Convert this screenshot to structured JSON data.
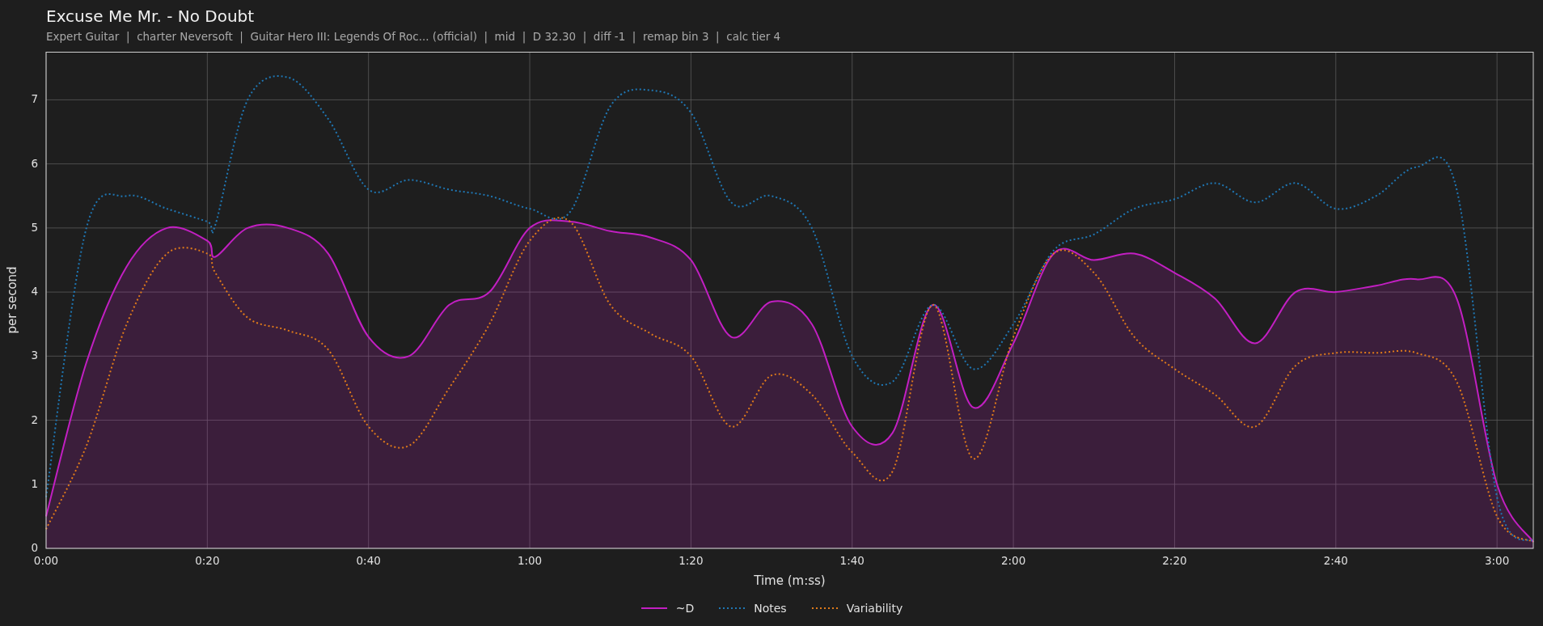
{
  "title": "Excuse Me Mr. - No Doubt",
  "subtitle": "Expert Guitar  |  charter Neversoft  |  Guitar Hero III: Legends Of Roc... (official)  |  mid  |  D 32.30  |  diff -1  |  remap bin 3  |  calc tier 4",
  "chart": {
    "chart_data": {
      "type": "line",
      "xlabel": "Time (m:ss)",
      "ylabel": "per second",
      "x": [
        0,
        5,
        10,
        15,
        20,
        21,
        25,
        30,
        35,
        40,
        45,
        50,
        55,
        60,
        65,
        70,
        75,
        80,
        85,
        90,
        95,
        100,
        105,
        110,
        115,
        120,
        125,
        130,
        135,
        140,
        145,
        150,
        155,
        160,
        165,
        170,
        175,
        180,
        184.5
      ],
      "series": [
        {
          "name": "~D",
          "color": "#c21fc2",
          "type": "area",
          "line_style": "solid",
          "values": [
            0.5,
            2.9,
            4.4,
            5.0,
            4.8,
            4.55,
            5.0,
            5.0,
            4.6,
            3.3,
            3.0,
            3.8,
            4.0,
            5.0,
            5.1,
            4.95,
            4.85,
            4.5,
            3.3,
            3.85,
            3.5,
            1.9,
            1.8,
            3.8,
            2.2,
            3.2,
            4.6,
            4.5,
            4.6,
            4.3,
            3.9,
            3.2,
            4.0,
            4.0,
            4.1,
            4.2,
            3.9,
            1.0,
            0.1
          ]
        },
        {
          "name": "Notes",
          "color": "#1f77b4",
          "type": "line",
          "line_style": "dotted",
          "values": [
            0.8,
            5.0,
            5.5,
            5.3,
            5.1,
            5.05,
            7.0,
            7.35,
            6.7,
            5.6,
            5.75,
            5.6,
            5.5,
            5.3,
            5.25,
            6.9,
            7.15,
            6.8,
            5.4,
            5.5,
            5.0,
            3.0,
            2.6,
            3.8,
            2.8,
            3.5,
            4.65,
            4.9,
            5.3,
            5.45,
            5.7,
            5.4,
            5.7,
            5.3,
            5.5,
            5.95,
            5.6,
            0.8,
            0.1
          ]
        },
        {
          "name": "Variability",
          "color": "#e07b1a",
          "type": "line",
          "line_style": "dotted",
          "values": [
            0.3,
            1.6,
            3.5,
            4.6,
            4.6,
            4.3,
            3.6,
            3.4,
            3.1,
            1.9,
            1.6,
            2.5,
            3.5,
            4.8,
            5.1,
            3.8,
            3.35,
            3.0,
            1.9,
            2.7,
            2.4,
            1.5,
            1.2,
            3.8,
            1.4,
            3.3,
            4.6,
            4.3,
            3.3,
            2.8,
            2.4,
            1.9,
            2.85,
            3.05,
            3.05,
            3.05,
            2.6,
            0.5,
            0.1
          ]
        }
      ],
      "grid": true,
      "xlim": [
        0,
        184.5
      ],
      "ylim": [
        0,
        7.75
      ],
      "xticks": [
        {
          "value": 0,
          "label": "0:00"
        },
        {
          "value": 20,
          "label": "0:20"
        },
        {
          "value": 40,
          "label": "0:40"
        },
        {
          "value": 60,
          "label": "1:00"
        },
        {
          "value": 80,
          "label": "1:20"
        },
        {
          "value": 100,
          "label": "1:40"
        },
        {
          "value": 120,
          "label": "2:00"
        },
        {
          "value": 140,
          "label": "2:20"
        },
        {
          "value": 160,
          "label": "2:40"
        },
        {
          "value": 180,
          "label": "3:00"
        }
      ],
      "yticks": [
        0,
        1,
        2,
        3,
        4,
        5,
        6,
        7
      ]
    }
  }
}
